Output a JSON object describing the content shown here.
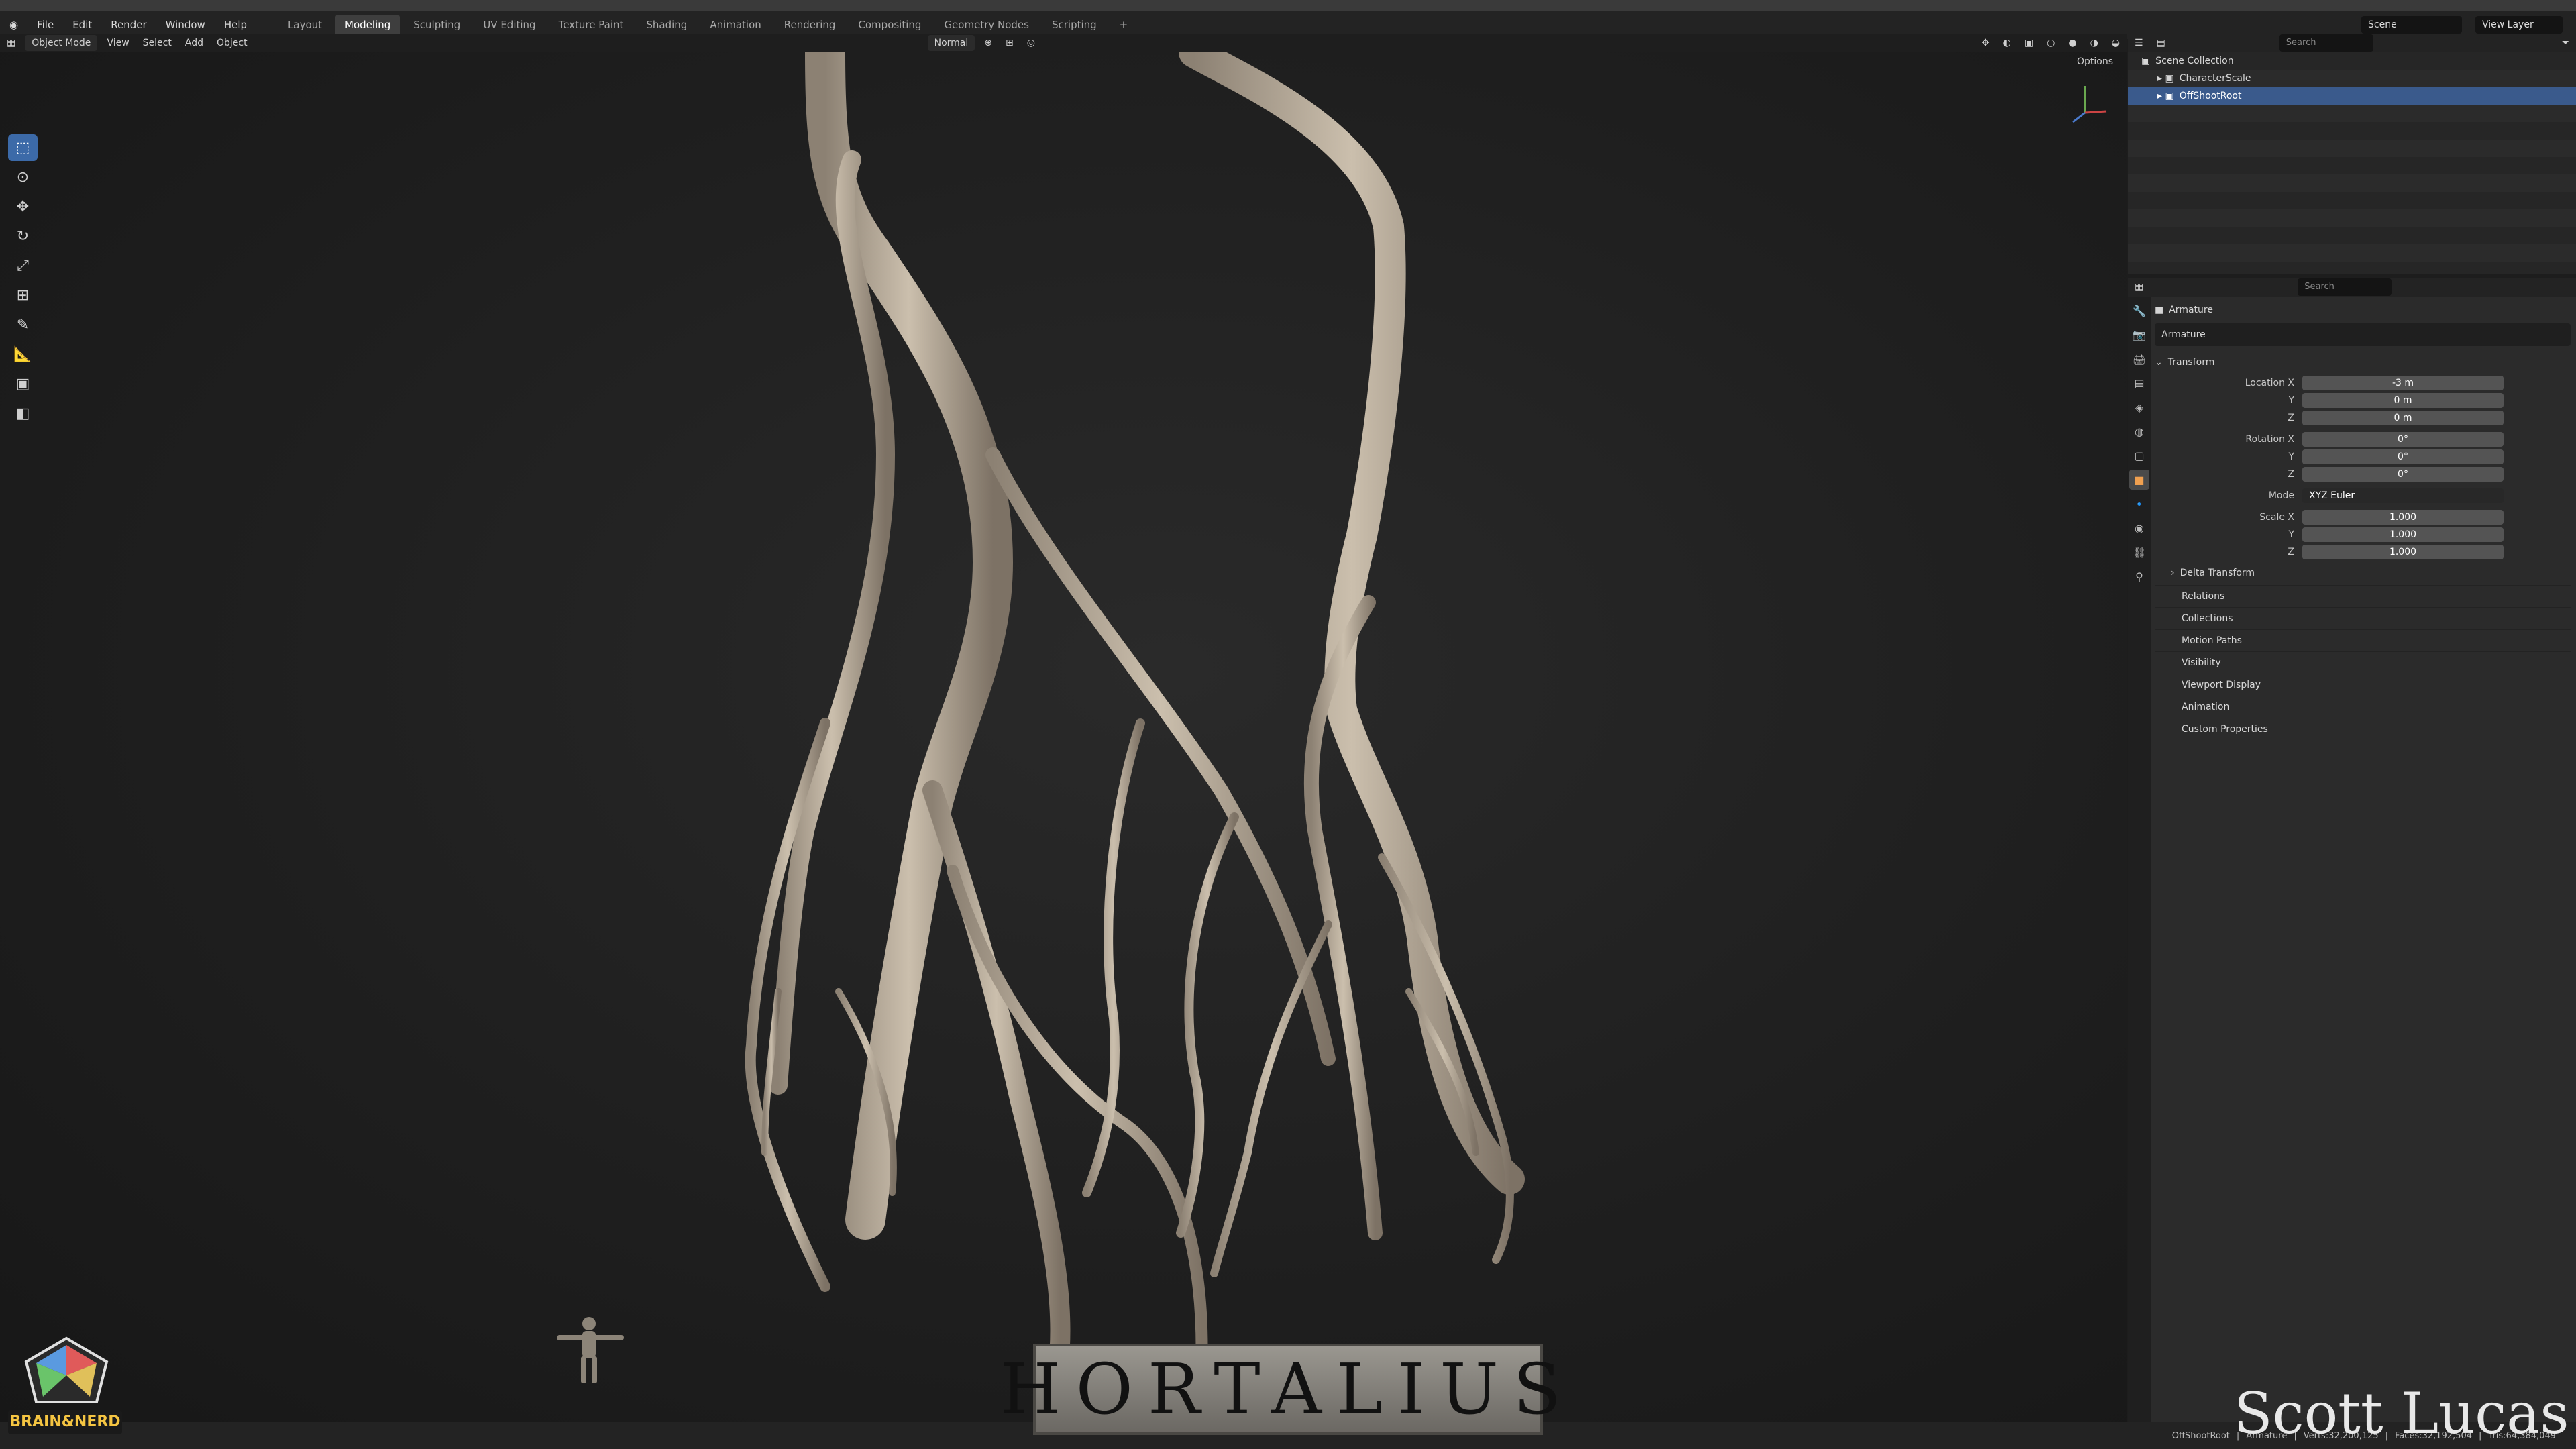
{
  "app_menu": [
    "File",
    "Edit",
    "Render",
    "Window",
    "Help"
  ],
  "workspace_tabs": [
    {
      "label": "Layout",
      "active": false
    },
    {
      "label": "Modeling",
      "active": true
    },
    {
      "label": "Sculpting",
      "active": false
    },
    {
      "label": "UV Editing",
      "active": false
    },
    {
      "label": "Texture Paint",
      "active": false
    },
    {
      "label": "Shading",
      "active": false
    },
    {
      "label": "Animation",
      "active": false
    },
    {
      "label": "Rendering",
      "active": false
    },
    {
      "label": "Compositing",
      "active": false
    },
    {
      "label": "Geometry Nodes",
      "active": false
    },
    {
      "label": "Scripting",
      "active": false
    }
  ],
  "add_workspace": "+",
  "scene": {
    "label": "Scene",
    "view_layer": "View Layer"
  },
  "viewport_header": {
    "mode": "Object Mode",
    "menus": [
      "View",
      "Select",
      "Add",
      "Object"
    ],
    "orientation": "Normal",
    "options": "Options"
  },
  "outliner": {
    "search_placeholder": "Search",
    "root": "Scene Collection",
    "items": [
      {
        "name": "CharacterScale",
        "selected": false
      },
      {
        "name": "OffShootRoot",
        "selected": true
      }
    ]
  },
  "properties": {
    "search_placeholder": "Search",
    "object_name": "Armature",
    "data_name": "Armature",
    "transform_label": "Transform",
    "location": {
      "label": "Location X",
      "x": "-3 m",
      "y": "0 m",
      "z": "0 m"
    },
    "rotation": {
      "label": "Rotation X",
      "x": "0°",
      "y": "0°",
      "z": "0°"
    },
    "mode": {
      "label": "Mode",
      "value": "XYZ Euler"
    },
    "scale": {
      "label": "Scale X",
      "x": "1.000",
      "y": "1.000",
      "z": "1.000"
    },
    "axis_labels": {
      "y": "Y",
      "z": "Z"
    },
    "delta_transform": "Delta Transform",
    "sections": [
      "Relations",
      "Collections",
      "Motion Paths",
      "Visibility",
      "Viewport Display",
      "Animation",
      "Custom Properties"
    ]
  },
  "status_bar": {
    "object": "OffShootRoot",
    "data": "Armature",
    "verts": "Verts:32,200,125",
    "faces": "Faces:32,192,504",
    "tris": "Tris:64,384,049"
  },
  "overlay": {
    "title": "HORTALIUS",
    "signature": "Scott Lucas",
    "logo": "BRAIN&NERD"
  },
  "colors": {
    "accent": "#3c6aa8",
    "root_bark": "#bfb2a0",
    "selected_row": "#3a5a8c"
  }
}
